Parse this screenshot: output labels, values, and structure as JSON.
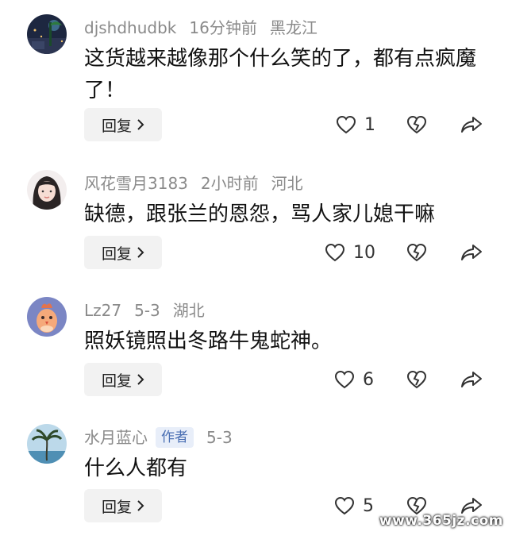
{
  "comments": [
    {
      "username": "djshdhudbk",
      "time": "16分钟前",
      "location": "黑龙江",
      "text": "这货越来越像那个什么笑的了，都有点疯魔了！",
      "reply_label": "回复",
      "likes": "1",
      "avatar": "night-scene-avatar"
    },
    {
      "username": "风花雪月3183",
      "time": "2小时前",
      "location": "河北",
      "text": "缺德，跟张兰的恩怨，骂人家儿媳干嘛",
      "reply_label": "回复",
      "likes": "10",
      "avatar": "girl-portrait-avatar"
    },
    {
      "username": "Lz27",
      "time": "5-3",
      "location": "湖北",
      "text": "照妖镜照出冬路牛鬼蛇神。",
      "reply_label": "回复",
      "likes": "6",
      "avatar": "cartoon-bird-avatar"
    },
    {
      "username": "水月蓝心",
      "badge": "作者",
      "time": "5-3",
      "text": "什么人都有",
      "reply_label": "回复",
      "likes": "5",
      "avatar": "palm-tree-avatar"
    }
  ],
  "watermark": "www.365jz.com",
  "colors": {
    "meta": "#8a8a8a",
    "badge_bg": "#e8eef9",
    "badge_text": "#4a6fb3",
    "button_bg": "#f2f2f2"
  }
}
